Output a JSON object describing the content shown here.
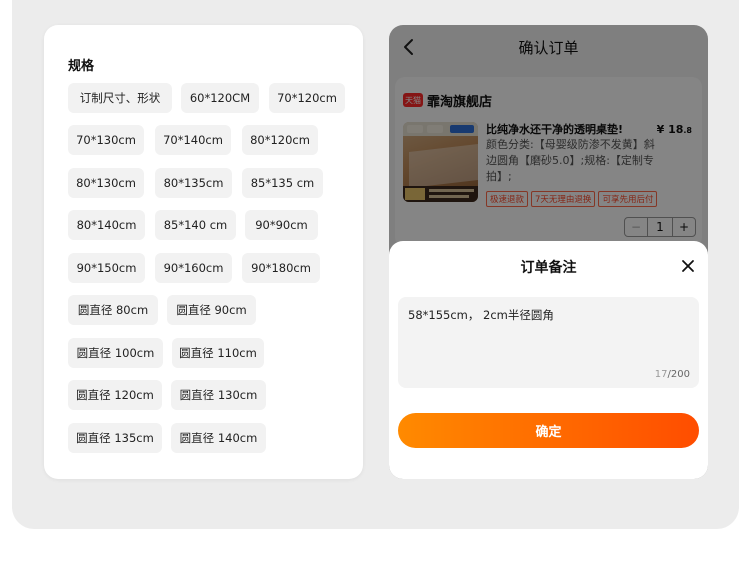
{
  "specs": {
    "title": "规格",
    "options": [
      "订制尺寸、形状",
      "60*120CM",
      "70*120cm",
      "70*130cm",
      "70*140cm",
      "80*120cm",
      "80*130cm",
      "80*135cm",
      "85*135 cm",
      "80*140cm",
      "85*140 cm",
      "90*90cm",
      "90*150cm",
      "90*160cm",
      "90*180cm",
      "圆直径 80cm",
      "圆直径 90cm",
      "圆直径 100cm",
      "圆直径 110cm",
      "圆直径 120cm",
      "圆直径 130cm",
      "圆直径 135cm",
      "圆直径 140cm"
    ]
  },
  "order_page": {
    "header_title": "确认订单",
    "shop": {
      "badge": "天猫",
      "name": "霏淘旗舰店"
    },
    "product": {
      "title": "比纯净水还干净的透明桌垫!",
      "spec": "颜色分类:【母婴级防渗不发黄】斜边圆角【磨砂5.0】;规格:【定制专拍】;",
      "price_symbol": "¥",
      "price_int": "18",
      "price_dec": ".8",
      "tags": [
        "极速退款",
        "7天无理由退换",
        "可享先用后付"
      ],
      "quantity": "1"
    }
  },
  "note_sheet": {
    "title": "订单备注",
    "note_value": "58*155cm， 2cm半径圆角",
    "count_current": "17",
    "count_max": "/200",
    "confirm_label": "确定"
  },
  "colors": {
    "accent_start": "#ff8a00",
    "accent_end": "#ff4d00",
    "brand_red": "#ff2a2a"
  }
}
